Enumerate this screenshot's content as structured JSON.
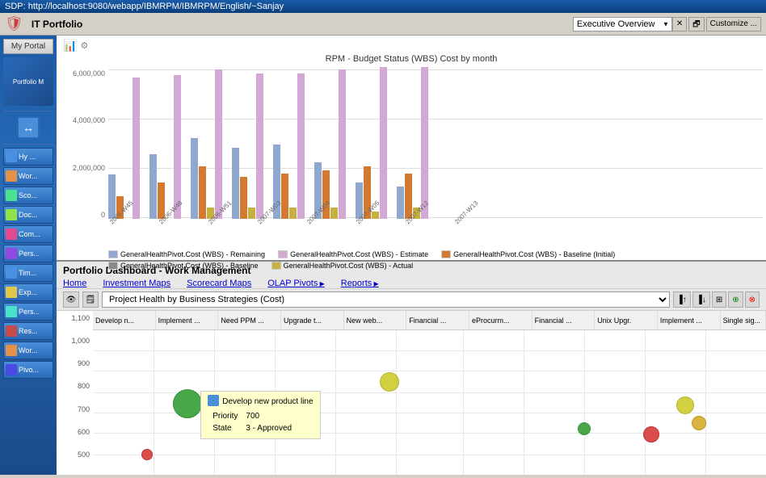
{
  "window": {
    "title": "SDP: http://localhost:9080/webapp/IBMRPM/IBMRPM/English/~Sanjay"
  },
  "header": {
    "portfolio_title": "IT Portfolio",
    "dropdown_label": "Executive Overview",
    "customize_label": "Customize ..."
  },
  "sidebar": {
    "my_portal": "My Portal",
    "portfolio_item": "Portfolio M",
    "items": [
      {
        "label": "Hy ...",
        "icon": "house"
      },
      {
        "label": "Wor...",
        "icon": "work"
      },
      {
        "label": "Sco...",
        "icon": "score"
      },
      {
        "label": "Doc...",
        "icon": "doc"
      },
      {
        "label": "Com...",
        "icon": "com"
      },
      {
        "label": "Pers...",
        "icon": "pers"
      },
      {
        "label": "Tim...",
        "icon": "time"
      },
      {
        "label": "Exp...",
        "icon": "exp"
      },
      {
        "label": "Pers...",
        "icon": "pers2"
      },
      {
        "label": "Res...",
        "icon": "res"
      },
      {
        "label": "Wor...",
        "icon": "work2"
      },
      {
        "label": "Pivo...",
        "icon": "pivot"
      }
    ]
  },
  "chart": {
    "title": "RPM - Budget Status (WBS) Cost by month",
    "y_axis": [
      "6,000,000",
      "4,000,000",
      "2,000,000",
      "0"
    ],
    "x_labels": [
      "2006-W45",
      "2006-W46",
      "2006-W51",
      "2007-W03",
      "2007-W04",
      "2007-W05",
      "2007-W12",
      "2007-W13"
    ],
    "legend": [
      {
        "label": "GeneralHealthPivot.Cost (WBS) - Remaining",
        "color": "#8fa8d0"
      },
      {
        "label": "GeneralHealthPivot.Cost (WBS) - Estimate",
        "color": "#d4a8d4"
      },
      {
        "label": "GeneralHealthPivot.Cost (WBS) - Baseline (Initial)",
        "color": "#d47a30"
      },
      {
        "label": "GeneralHealthPivot.Cost (WBS) - Baseline",
        "color": "#8a8a8a"
      },
      {
        "label": "GeneralHealthPivot.Cost (WBS) - Actual",
        "color": "#c8b040"
      }
    ],
    "bars": [
      {
        "remaining": 30,
        "baseline_init": 15,
        "actual": 0,
        "estimate": 95,
        "baseline": 0
      },
      {
        "remaining": 45,
        "baseline_init": 25,
        "actual": 0,
        "estimate": 95,
        "baseline": 0
      },
      {
        "remaining": 55,
        "baseline_init": 35,
        "actual": 8,
        "estimate": 100,
        "baseline": 0
      },
      {
        "remaining": 48,
        "baseline_init": 28,
        "actual": 8,
        "estimate": 97,
        "baseline": 0
      },
      {
        "remaining": 50,
        "baseline_init": 30,
        "actual": 8,
        "estimate": 97,
        "baseline": 0
      },
      {
        "remaining": 38,
        "baseline_init": 32,
        "actual": 8,
        "estimate": 100,
        "baseline": 0
      },
      {
        "remaining": 25,
        "baseline_init": 35,
        "actual": 5,
        "estimate": 102,
        "baseline": 0
      },
      {
        "remaining": 22,
        "baseline_init": 30,
        "actual": 8,
        "estimate": 102,
        "baseline": 0
      }
    ]
  },
  "dashboard": {
    "title": "Portfolio Dashboard - Work Management",
    "nav": {
      "home": "Home",
      "investment_maps": "Investment Maps",
      "scorecard_maps": "Scorecard Maps",
      "olap_pivots": "OLAP Pivots",
      "reports": "Reports"
    },
    "view_select": "Project Health by Business Strategies (Cost)",
    "col_headers": [
      "Develop n...",
      "Implement ...",
      "Need PPM ...",
      "Upgrade t...",
      "New web...",
      "Financial ...",
      "eProcurm...",
      "Financial ...",
      "Unix Upgr.",
      "Implement ...",
      "Single sig..."
    ],
    "y_axis_labels": [
      "1,100",
      "1,000",
      "900",
      "800",
      "700",
      "600",
      "500"
    ],
    "bubbles": [
      {
        "x": 14,
        "y": 49,
        "size": 36,
        "color": "#2a9a2a",
        "col": 1
      },
      {
        "x": 46,
        "y": 37,
        "size": 24,
        "color": "#c8c820",
        "col": 4
      },
      {
        "x": 83,
        "y": 73,
        "size": 20,
        "color": "#d43030",
        "col": 7
      },
      {
        "x": 90,
        "y": 65,
        "size": 18,
        "color": "#d4a820",
        "col": 7
      },
      {
        "x": 73,
        "y": 70,
        "size": 16,
        "color": "#2a9a2a",
        "col": 6
      },
      {
        "x": 88,
        "y": 55,
        "size": 18,
        "color": "#c8c820",
        "col": 8
      }
    ],
    "tooltip": {
      "project": "Develop new product line",
      "priority_label": "Priority",
      "priority_value": "700",
      "state_label": "State",
      "state_value": "3 - Approved"
    }
  }
}
